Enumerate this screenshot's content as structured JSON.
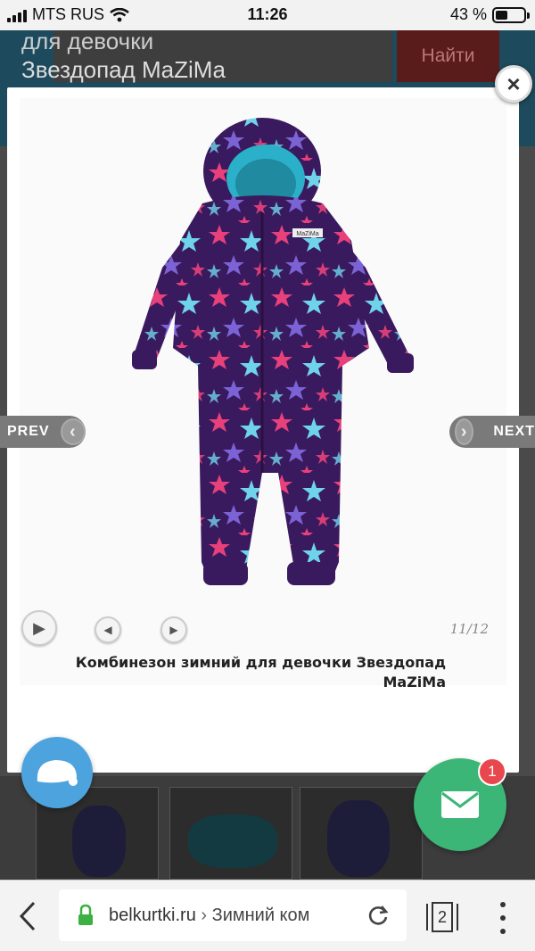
{
  "status_bar": {
    "carrier": "MTS RUS",
    "time": "11:26",
    "battery_percent": "43 %",
    "battery_level": 0.43
  },
  "background_page": {
    "title_line1": "для девочки",
    "title_line2": "Звездопад MaZiMa",
    "search_button": "Найти"
  },
  "lightbox": {
    "image_alt": "Комбинезон зимний для девочки Звездопад MaZiMa",
    "prev_label": "PREV",
    "next_label": "NEXT",
    "close_label": "×",
    "counter": "11/12",
    "caption": "Комбинезон зимний для девочки Звездопад MaZiMa",
    "product_tag": "MaZiMa"
  },
  "widgets": {
    "mail_badge_count": "1"
  },
  "browser": {
    "domain": "belkurtki.ru",
    "separator": "›",
    "page_title": "Зимний ком",
    "tab_count": "2"
  },
  "colors": {
    "suit_purple": "#3a1a5e",
    "star_pink": "#e8407a",
    "star_cyan": "#6fd3ea",
    "star_violet": "#7b63d6",
    "chat_blue": "#4da3dd",
    "mail_green": "#3cb676",
    "badge_red": "#e8484d"
  }
}
